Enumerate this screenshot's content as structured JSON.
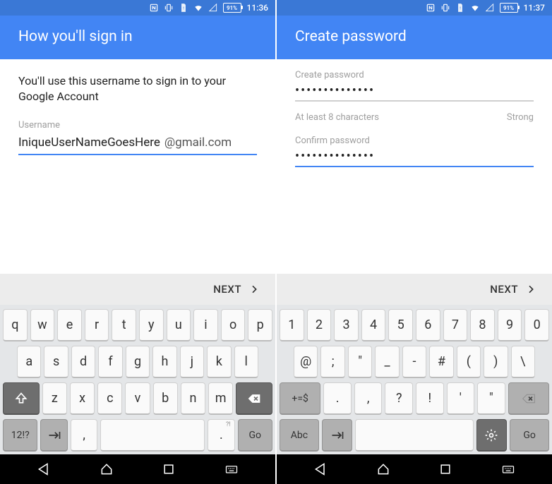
{
  "left": {
    "status": {
      "battery": "91%",
      "time": "11:36"
    },
    "header": "How you'll sign in",
    "subtitle": "You'll use this username to sign in to your Google Account",
    "username_label": "Username",
    "username_value": "IniqueUserNameGoesHere",
    "username_suffix": "@gmail.com",
    "next": "NEXT",
    "keyboard": {
      "row1": [
        "q",
        "w",
        "e",
        "r",
        "t",
        "y",
        "u",
        "i",
        "o",
        "p"
      ],
      "row2": [
        "a",
        "s",
        "d",
        "f",
        "g",
        "h",
        "j",
        "k",
        "l"
      ],
      "row3": [
        "z",
        "x",
        "c",
        "v",
        "b",
        "n",
        "m"
      ],
      "mode": "12!?",
      "comma": ",",
      "period": ".",
      "period_sup": "?!",
      "go": "Go"
    }
  },
  "right": {
    "status": {
      "battery": "91%",
      "time": "11:37"
    },
    "header": "Create password",
    "create_label": "Create password",
    "create_value": "••••••••••••••",
    "helper": "At least 8 characters",
    "strength": "Strong",
    "confirm_label": "Confirm password",
    "confirm_value": "••••••••••••••",
    "next": "NEXT",
    "keyboard": {
      "row1": [
        "1",
        "2",
        "3",
        "4",
        "5",
        "6",
        "7",
        "8",
        "9",
        "0"
      ],
      "row2": [
        "@",
        ";",
        "\"",
        "_",
        "-",
        "#",
        "(",
        ")",
        "\\"
      ],
      "row3": [
        ".",
        ",",
        "?",
        "!",
        "'",
        "\""
      ],
      "mode_sym": "+=$",
      "mode_abc": "Abc",
      "go": "Go"
    }
  }
}
